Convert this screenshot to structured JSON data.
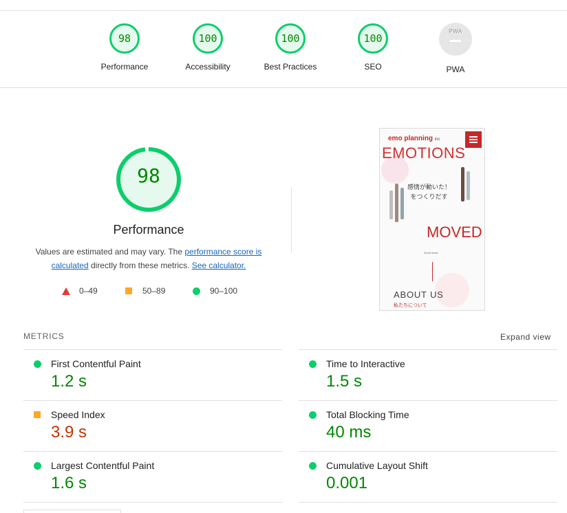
{
  "categories": [
    {
      "score": "98",
      "label": "Performance"
    },
    {
      "score": "100",
      "label": "Accessibility"
    },
    {
      "score": "100",
      "label": "Best Practices"
    },
    {
      "score": "100",
      "label": "SEO"
    }
  ],
  "pwa": {
    "label": "PWA",
    "badge_text": "PWA"
  },
  "performance": {
    "score": "98",
    "score_fraction": 0.98,
    "title": "Performance",
    "desc_pre": "Values are estimated and may vary. The ",
    "desc_link1": "performance score is calculated",
    "desc_mid": " directly from these metrics. ",
    "desc_link2": "See calculator."
  },
  "legend": {
    "fail": "0–49",
    "average": "50–89",
    "pass": "90–100"
  },
  "screenshot": {
    "logo_brand": "emo",
    "logo_rest": " planning",
    "logo_suffix": "inc",
    "headline1": "EMOTIONS",
    "jp_line1": "感情が動いた！",
    "jp_line2": "をつくりだす",
    "headline2": "MOVED",
    "small_text": "Scroll down",
    "about": "ABOUT US",
    "about_jp": "私たちについて"
  },
  "metrics": {
    "title": "METRICS",
    "expand": "Expand view",
    "items": [
      {
        "label": "First Contentful Paint",
        "value": "1.2 s",
        "status": "pass"
      },
      {
        "label": "Time to Interactive",
        "value": "1.5 s",
        "status": "pass"
      },
      {
        "label": "Speed Index",
        "value": "3.9 s",
        "status": "average"
      },
      {
        "label": "Total Blocking Time",
        "value": "40 ms",
        "status": "pass"
      },
      {
        "label": "Largest Contentful Paint",
        "value": "1.6 s",
        "status": "pass"
      },
      {
        "label": "Cumulative Layout Shift",
        "value": "0.001",
        "status": "pass"
      }
    ]
  },
  "colors": {
    "pass": "#0cce6b",
    "average": "#ffa726",
    "fail": "#e53935",
    "pass_text": "#008800",
    "average_text": "#c33300"
  }
}
